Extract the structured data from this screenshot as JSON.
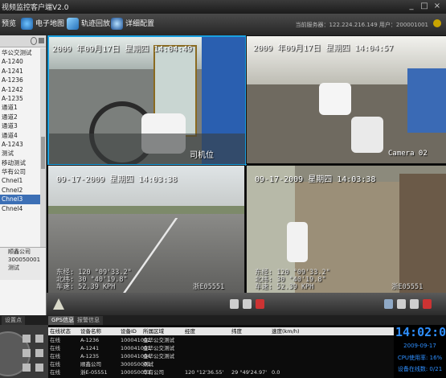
{
  "window": {
    "title": "视频监控客户端V2.0",
    "min": "_",
    "max": "□",
    "close": "×"
  },
  "toolbar": {
    "buttons": [
      {
        "label": "预览"
      },
      {
        "label": "电子地图"
      },
      {
        "label": "轨迹回放"
      },
      {
        "label": "详细配置"
      }
    ],
    "status": "当前服务器：122.224.216.149  用户：200001001"
  },
  "sidebar": {
    "items": [
      "华公交测试",
      "A-1240",
      "A-1241",
      "A-1236",
      "A-1242",
      "A-1235",
      "通道1",
      "通道2",
      "通道3",
      "通道4",
      "A-1243",
      "测试",
      "移动测试",
      "华有公司",
      "Chnel1",
      "Chnel2",
      "Chnel3",
      "Chnel4"
    ],
    "selected_index": 16,
    "info": [
      "顺鑫公司",
      "300050001",
      "测试"
    ]
  },
  "cams": [
    {
      "timestamp": "2009 年09月17日 星期四 14:04:49",
      "overlay": "司机位",
      "selected": true
    },
    {
      "timestamp": "2009 年09月17日 星期四 14:04:57",
      "overlay": "Camera 02",
      "selected": false
    },
    {
      "timestamp": "09-17-2009 星期四 14:03:38",
      "lon": "东经: 120 °09'33.2\"",
      "lat": "北纬: 30 °40'19.8\"",
      "speed": "车速: 52.39 KPH",
      "plate": "浙E05551",
      "selected": false
    },
    {
      "timestamp": "09-17-2009 星期四 14:03:38",
      "lon": "东经: 120 °09'33.2\"",
      "lat": "北纬: 30 °40'19.8\"",
      "speed": "车速: 52.39 KPH",
      "plate": "浙E05551",
      "selected": false
    }
  ],
  "tabs": [
    {
      "label": "设置点"
    },
    {
      "label": "GPS信息"
    },
    {
      "label": "报警信息"
    }
  ],
  "table": {
    "headers": [
      "在线状态",
      "设备名称",
      "设备ID",
      "所属区域",
      "经度",
      "纬度",
      "速度(km/h)"
    ],
    "rows": [
      [
        "在线",
        "A-1236",
        "100041002",
        "金华公交测试",
        "",
        "",
        ""
      ],
      [
        "在线",
        "A-1241",
        "100041001",
        "金华公交测试",
        "",
        "",
        ""
      ],
      [
        "在线",
        "A-1235",
        "100041004",
        "金华公交测试",
        "",
        "",
        ""
      ],
      [
        "在线",
        "顺鑫公司",
        "300050001",
        "测试",
        "",
        "",
        ""
      ],
      [
        "在线",
        "浙E-05551",
        "100050001",
        "华有公司",
        "120 °12'36.55'",
        "29 °49'24.97'",
        "0.0"
      ]
    ]
  },
  "clock": {
    "time": "14:02:00",
    "date": "2009-09-17",
    "cpu": "CPU使用率: 16%",
    "online": "设备在线数: 0/21"
  },
  "colors": {
    "accent": "#19a0e0",
    "online": "#2e7d32",
    "clock": "#1e88ff"
  }
}
